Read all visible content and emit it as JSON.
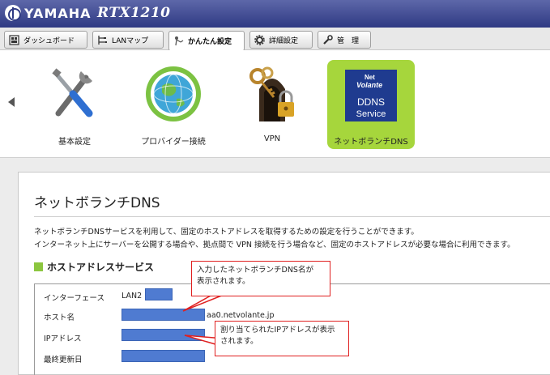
{
  "header": {
    "brand": "YAMAHA",
    "model": "RTX1210"
  },
  "tabs": [
    {
      "label": "ダッシュボード",
      "icon": "dashboard-icon"
    },
    {
      "label": "LANマップ",
      "icon": "lan-map-icon"
    },
    {
      "label": "かんたん設定",
      "icon": "easy-setup-icon"
    },
    {
      "label": "詳細設定",
      "icon": "gear-icon"
    },
    {
      "label": "管　理",
      "icon": "wrench-icon"
    }
  ],
  "active_tab": "かんたん設定",
  "icon_items": [
    {
      "label": "基本設定",
      "icon": "tools-icon"
    },
    {
      "label": "プロバイダー接続",
      "icon": "globe-icon"
    },
    {
      "label": "VPN",
      "icon": "keys-lock-icon"
    },
    {
      "label": "ネットボランチDNS",
      "icon": "ddns-service-icon"
    }
  ],
  "ddns_logo": {
    "line1": "Net",
    "line2": "Volante",
    "line3": "DDNS",
    "line4": "Service"
  },
  "page": {
    "title": "ネットボランチDNS",
    "description_1": "ネットボランチDNSサービスを利用して、固定のホストアドレスを取得するための設定を行うことができます。",
    "description_2": "インターネット上にサーバーを公開する場合や、拠点間で VPN 接続を行う場合など、固定のホストアドレスが必要な場合に利用できます。"
  },
  "section": {
    "title": "ホストアドレスサービス",
    "rows": [
      {
        "label": "インターフェース",
        "value": "LAN2"
      },
      {
        "label": "ホスト名",
        "value": "aa0.netvolante.jp"
      },
      {
        "label": "IPアドレス",
        "value": ""
      },
      {
        "label": "最終更新日",
        "value": ""
      }
    ]
  },
  "callouts": [
    {
      "line1": "入力したネットボランチDNS名が",
      "line2": "表示されます。"
    },
    {
      "line1": "割り当てられたIPアドレスが表示",
      "line2": "されます。"
    }
  ],
  "colors": {
    "header_bg": "#2f3a83",
    "active_item_bg": "#a6d63c",
    "section_marker": "#8cc63f",
    "redacted_blue": "#4f7bd1",
    "callout_border": "#e02020"
  }
}
